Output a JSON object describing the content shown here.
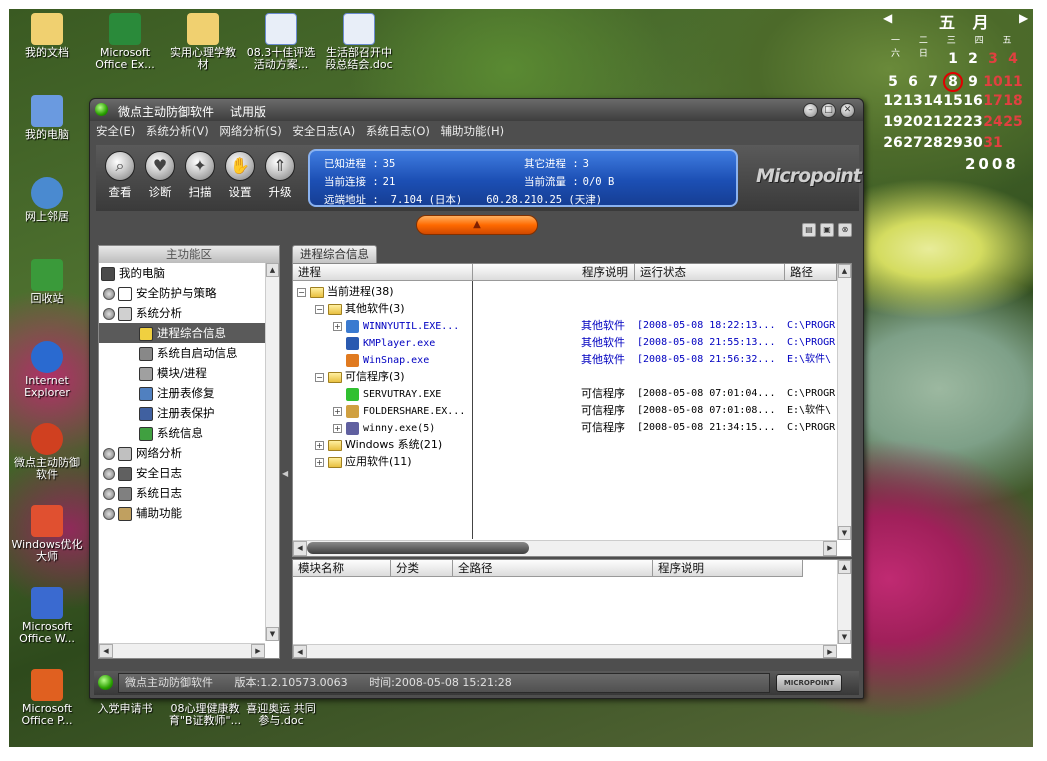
{
  "desktop": {
    "icons": [
      {
        "label": "我的文档",
        "icon": "my-documents-icon",
        "color": "#f0d070"
      },
      {
        "label": "我的电脑",
        "icon": "my-computer-icon",
        "color": "#6a9ae0"
      },
      {
        "label": "网上邻居",
        "icon": "network-icon",
        "color": "#4a8ad0"
      },
      {
        "label": "回收站",
        "icon": "recycle-bin-icon",
        "color": "#3a9a3a"
      },
      {
        "label": "Internet Explorer",
        "icon": "ie-icon",
        "color": "#2a6ad0"
      },
      {
        "label": "微点主动防御软件",
        "icon": "micropoint-shortcut-icon",
        "color": "#d04020"
      },
      {
        "label": "Windows优化大师",
        "icon": "optimizer-icon",
        "color": "#e05030"
      },
      {
        "label": "Microsoft Office W...",
        "icon": "word-icon",
        "color": "#3a6ad0"
      },
      {
        "label": "Microsoft Office P...",
        "icon": "powerpoint-icon",
        "color": "#e06020"
      }
    ],
    "top_icons": [
      {
        "label": "Microsoft Office Ex...",
        "icon": "excel-icon",
        "color": "#2a8a3a"
      },
      {
        "label": "实用心理学教材",
        "icon": "folder-icon",
        "color": "#f0d070"
      },
      {
        "label": "08.3十佳评选活动方案...",
        "icon": "word-doc-icon",
        "color": "#e8eef8"
      },
      {
        "label": "生活部召开中段总结会.doc",
        "icon": "word-doc-icon",
        "color": "#e8eef8"
      }
    ],
    "bottom_icons": [
      {
        "label": "入党申请书"
      },
      {
        "label": "08心理健康教育\"B证教师\"..."
      },
      {
        "label": "喜迎奥运 共同参与.doc"
      }
    ]
  },
  "calendar": {
    "month": "五 月",
    "weekdays": "一 二 三 四 五 六 日",
    "rows": [
      [
        "",
        "",
        "",
        "1",
        "2",
        "3",
        "4"
      ],
      [
        "5",
        "6",
        "7",
        "8",
        "9",
        "10",
        "11"
      ],
      [
        "12",
        "13",
        "14",
        "15",
        "16",
        "17",
        "18"
      ],
      [
        "19",
        "20",
        "21",
        "22",
        "23",
        "24",
        "25"
      ],
      [
        "26",
        "27",
        "28",
        "29",
        "30",
        "31",
        ""
      ]
    ],
    "side_numbers": [
      "18",
      "19",
      "20",
      "21",
      "22"
    ],
    "today": "8",
    "year": "2008"
  },
  "app": {
    "title": "微点主动防御软件",
    "edition": "试用版",
    "menu": [
      "安全(E)",
      "系统分析(V)",
      "网络分析(S)",
      "安全日志(A)",
      "系统日志(O)",
      "辅助功能(H)"
    ],
    "toolbar": [
      {
        "label": "查看",
        "icon": "magnifier-icon",
        "glyph": "⌕"
      },
      {
        "label": "诊断",
        "icon": "diagnose-icon",
        "glyph": "♥"
      },
      {
        "label": "扫描",
        "icon": "scan-icon",
        "glyph": "✦"
      },
      {
        "label": "设置",
        "icon": "settings-icon",
        "glyph": "✋"
      },
      {
        "label": "升级",
        "icon": "upgrade-icon",
        "glyph": "⇑"
      }
    ],
    "info": {
      "known_label": "已知进程 :",
      "known_value": "35",
      "other_label": "其它进程 :",
      "other_value": "3",
      "conn_label": "当前连接 :",
      "conn_value": "21",
      "flow_label": "当前流量 :",
      "flow_value": "0/0 B",
      "remote_label": "远端地址 :",
      "remote_value": "7.104 (日本)",
      "remote_value2": "60.28.210.25 (天津)"
    },
    "logo": "Micropoint",
    "left_panel": {
      "header": "主功能区",
      "items": [
        {
          "label": "我的电脑",
          "level": 0,
          "icon": "computer-icon",
          "color": "#4a4a4a",
          "expander": false,
          "selected": false
        },
        {
          "label": "安全防护与策略",
          "level": 1,
          "icon": "shield-policy-icon",
          "color": "#ffffff",
          "expander": true,
          "selected": false
        },
        {
          "label": "系统分析",
          "level": 1,
          "icon": "system-analysis-icon",
          "color": "#d0d0d0",
          "expander": true,
          "selected": false
        },
        {
          "label": "进程综合信息",
          "level": 2,
          "icon": "process-info-icon",
          "color": "#f0d040",
          "expander": false,
          "selected": true
        },
        {
          "label": "系统自启动信息",
          "level": 2,
          "icon": "startup-icon",
          "color": "#888888",
          "expander": false,
          "selected": false
        },
        {
          "label": "模块/进程",
          "level": 2,
          "icon": "module-icon",
          "color": "#a0a0a0",
          "expander": false,
          "selected": false
        },
        {
          "label": "注册表修复",
          "level": 2,
          "icon": "registry-repair-icon",
          "color": "#5080c0",
          "expander": false,
          "selected": false
        },
        {
          "label": "注册表保护",
          "level": 2,
          "icon": "registry-protect-icon",
          "color": "#4060a0",
          "expander": false,
          "selected": false
        },
        {
          "label": "系统信息",
          "level": 2,
          "icon": "system-info-icon",
          "color": "#40a040",
          "expander": false,
          "selected": false
        },
        {
          "label": "网络分析",
          "level": 1,
          "icon": "network-analysis-icon",
          "color": "#c0c0c0",
          "expander": true,
          "selected": false
        },
        {
          "label": "安全日志",
          "level": 1,
          "icon": "security-log-icon",
          "color": "#606060",
          "expander": true,
          "selected": false
        },
        {
          "label": "系统日志",
          "level": 1,
          "icon": "system-log-icon",
          "color": "#808080",
          "expander": true,
          "selected": false
        },
        {
          "label": "辅助功能",
          "level": 1,
          "icon": "assist-icon",
          "color": "#c0a060",
          "expander": true,
          "selected": false
        }
      ]
    },
    "tab": "进程综合信息",
    "process_columns": [
      "进程",
      "程序说明",
      "运行状态",
      "路径"
    ],
    "process_rows": [
      {
        "name": "当前进程(38)",
        "level": 0,
        "type": "folder",
        "box": "⊟"
      },
      {
        "name": "其他软件(3)",
        "level": 1,
        "type": "folder",
        "box": "⊟"
      },
      {
        "name": "WINNYUTIL.EXE...",
        "level": 2,
        "type": "proc",
        "box": "⊞",
        "link": true,
        "icon": "winny-util-icon",
        "color": "#3a7ad0",
        "desc": "其他软件",
        "time": "[2008-05-08 18:22:13...",
        "path": "C:\\PROGR"
      },
      {
        "name": "KMPlayer.exe",
        "level": 2,
        "type": "proc",
        "box": "",
        "link": true,
        "icon": "kmplayer-icon",
        "color": "#2a5ab0",
        "desc": "其他软件",
        "time": "[2008-05-08 21:55:13...",
        "path": "C:\\PROGR"
      },
      {
        "name": "WinSnap.exe",
        "level": 2,
        "type": "proc",
        "box": "",
        "link": true,
        "icon": "winsnap-icon",
        "color": "#e07a20",
        "desc": "其他软件",
        "time": "[2008-05-08 21:56:32...",
        "path": "E:\\软件\\"
      },
      {
        "name": "可信程序(3)",
        "level": 1,
        "type": "folder",
        "box": "⊟"
      },
      {
        "name": "SERVUTRAY.EXE",
        "level": 2,
        "type": "proc",
        "box": "",
        "link": false,
        "icon": "servutray-icon",
        "color": "#30c030",
        "desc": "可信程序",
        "time": "[2008-05-08 07:01:04...",
        "path": "C:\\PROGR"
      },
      {
        "name": "FOLDERSHARE.EX...",
        "level": 2,
        "type": "proc",
        "box": "⊞",
        "link": false,
        "icon": "foldershare-icon",
        "color": "#d0a040",
        "desc": "可信程序",
        "time": "[2008-05-08 07:01:08...",
        "path": "E:\\软件\\"
      },
      {
        "name": "winny.exe(5)",
        "level": 2,
        "type": "proc",
        "box": "⊞",
        "link": false,
        "icon": "winny-icon",
        "color": "#6060a0",
        "desc": "可信程序",
        "time": "[2008-05-08 21:34:15...",
        "path": "C:\\PROGR"
      },
      {
        "name": "Windows 系统(21)",
        "level": 1,
        "type": "folder",
        "box": "⊞"
      },
      {
        "name": "应用软件(11)",
        "level": 1,
        "type": "folder",
        "box": "⊞"
      }
    ],
    "module_columns": [
      "模块名称",
      "分类",
      "全路径",
      "程序说明"
    ],
    "status": {
      "name": "微点主动防御软件",
      "version": "版本:1.2.10573.0063",
      "time": "时间:2008-05-08 15:21:28",
      "logo": "MICROPOINT"
    }
  }
}
